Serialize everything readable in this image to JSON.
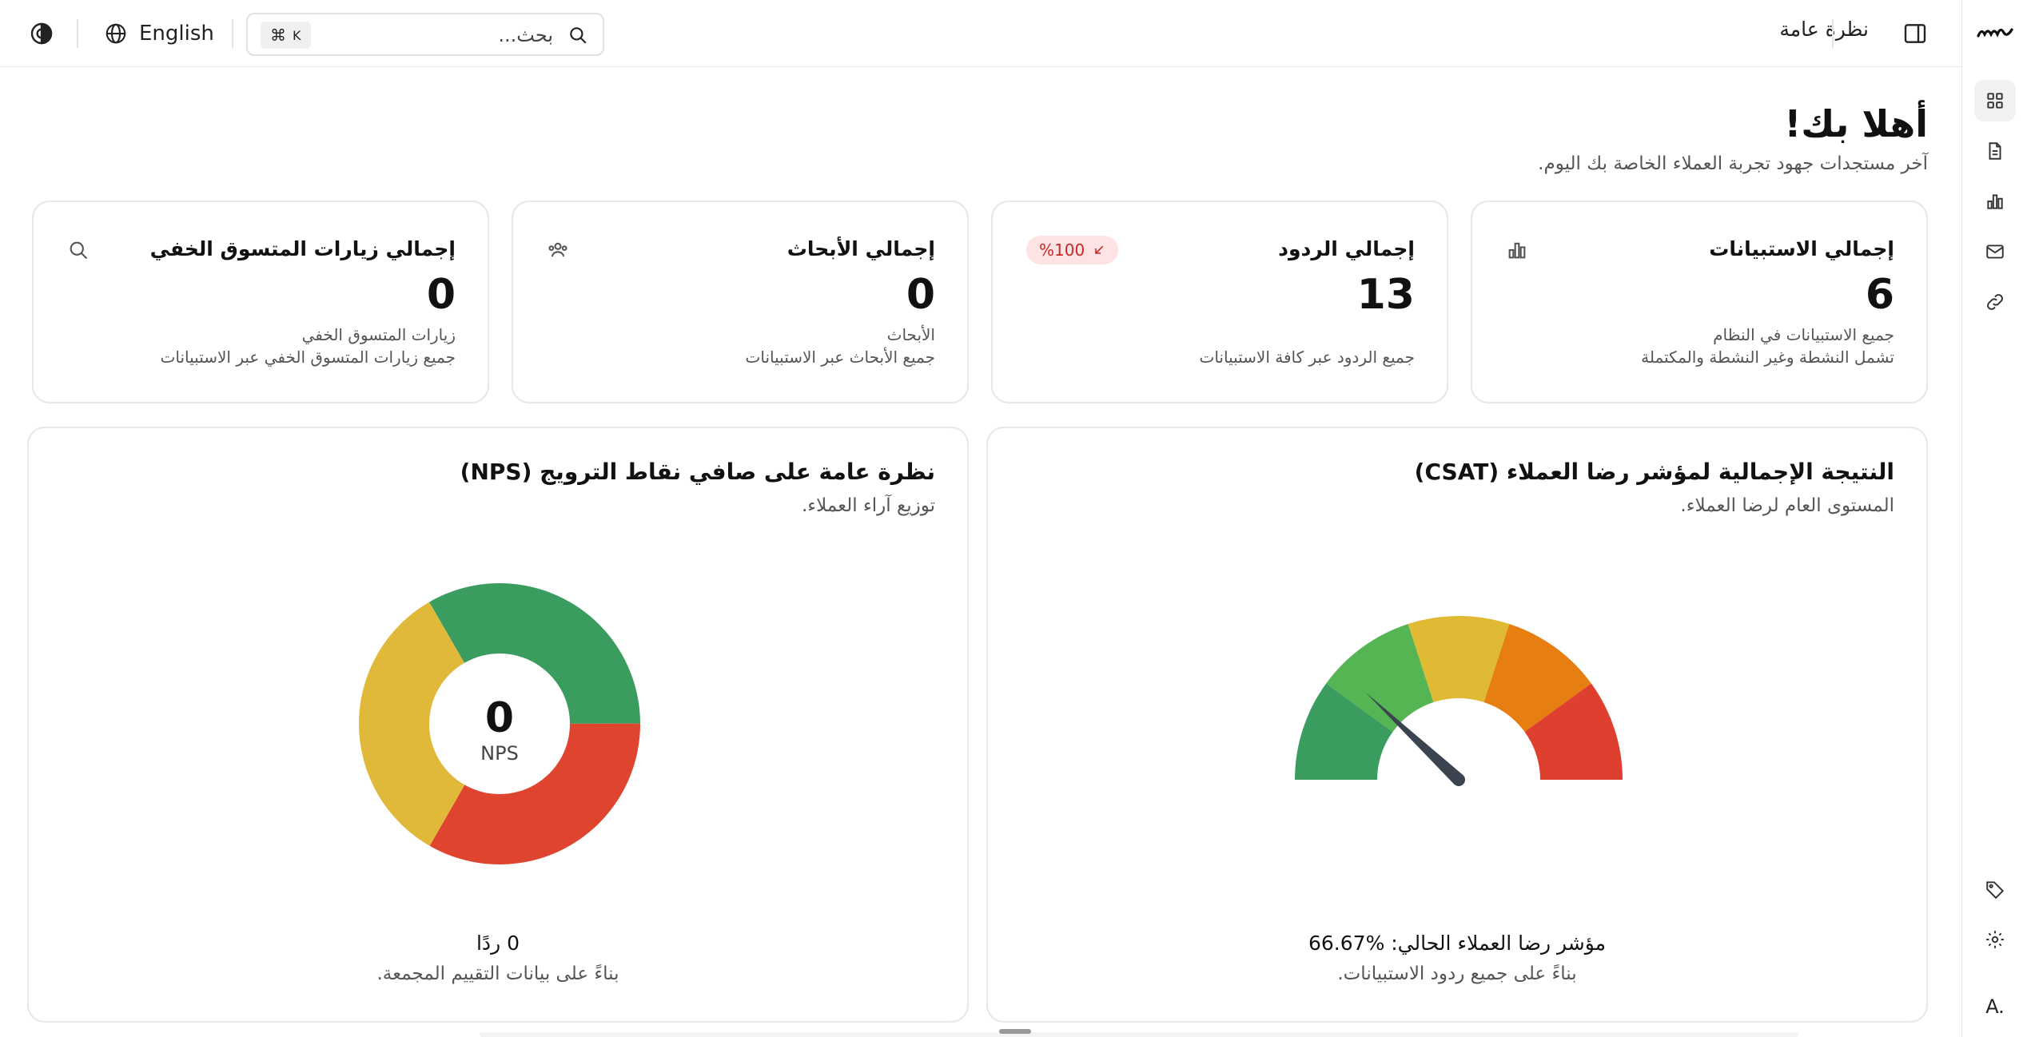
{
  "header": {
    "crumb": "نظرة عامة",
    "language_label": "English",
    "search_placeholder": "بحث...",
    "shortcut_cmd": "⌘",
    "shortcut_key": "K"
  },
  "sidebar": {
    "items": [
      {
        "name": "dashboard",
        "icon": "grid-icon"
      },
      {
        "name": "surveys",
        "icon": "document-icon"
      },
      {
        "name": "reports",
        "icon": "bar-chart-icon"
      },
      {
        "name": "messages",
        "icon": "mail-icon"
      },
      {
        "name": "links",
        "icon": "link-icon"
      },
      {
        "name": "tags",
        "icon": "tag-icon"
      },
      {
        "name": "settings",
        "icon": "gear-icon"
      }
    ],
    "avatar": "A."
  },
  "welcome": {
    "title": "أهلا بك!",
    "subtitle": "آخر مستجدات جهود تجربة العملاء الخاصة بك اليوم."
  },
  "stats": [
    {
      "title": "إجمالي الاستبيانات",
      "value": "6",
      "sub1": "جميع الاستبيانات في النظام",
      "sub2": "تشمل النشطة وغير النشطة والمكتملة",
      "icon": "bar-chart-icon"
    },
    {
      "title": "إجمالي الردود",
      "value": "13",
      "sub1": "",
      "sub2": "جميع الردود عبر كافة الاستبيانات",
      "badge": "%100"
    },
    {
      "title": "إجمالي الأبحاث",
      "value": "0",
      "sub1": "الأبحاث",
      "sub2": "جميع الأبحاث عبر الاستبيانات",
      "icon": "users-icon"
    },
    {
      "title": "إجمالي زيارات المتسوق الخفي",
      "value": "0",
      "sub1": "زيارات المتسوق الخفي",
      "sub2": "جميع زيارات المتسوق الخفي عبر الاستبيانات",
      "icon": "search-icon"
    }
  ],
  "csat": {
    "title": "النتيجة الإجمالية لمؤشر رضا العملاء (CSAT)",
    "subtitle": "المستوى العام لرضا العملاء.",
    "footer_main": "مؤشر رضا العملاء الحالي: %66.67",
    "footer_sub": "بناءً على جميع ردود الاستبيانات."
  },
  "nps": {
    "title": "نظرة عامة على صافي نقاط الترويج (NPS)",
    "subtitle": "توزيع آراء العملاء.",
    "center_value": "0",
    "center_label": "NPS",
    "footer_main": "0 ردًا",
    "footer_sub": "بناءً على بيانات التقييم المجمعة."
  },
  "chart_data": [
    {
      "type": "gauge",
      "value_percent": 66.67,
      "range": [
        0,
        100
      ],
      "segments": [
        {
          "color": "#3a9c5f"
        },
        {
          "color": "#55b553"
        },
        {
          "color": "#e0b935"
        },
        {
          "color": "#e67e12"
        },
        {
          "color": "#df3f2e"
        }
      ],
      "needle_color": "#3b4250"
    },
    {
      "type": "pie",
      "slices": [
        {
          "value": 33.3,
          "color": "#3a9c5f"
        },
        {
          "value": 33.3,
          "color": "#df452e"
        },
        {
          "value": 33.4,
          "color": "#e0b93a"
        }
      ]
    }
  ]
}
